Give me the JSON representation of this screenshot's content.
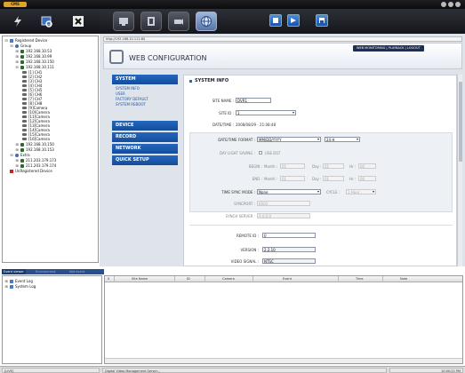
{
  "app": {
    "logo": "CMS"
  },
  "address": "http://192.168.10.111:80",
  "config": {
    "title": "WEB CONFIGURATION"
  },
  "topnav": "WEB MONITORING  |  PLAYBACK  |  LOGOUT",
  "tree": {
    "root": "Registered Device",
    "group": "Group",
    "ips_a": [
      "192.168.10.53",
      "192.168.10.99",
      "192.168.10.150",
      "192.168.10.111"
    ],
    "cams": [
      "[1] CH1",
      "[2] CH2",
      "[3] CH3",
      "[4] CH4",
      "[5] CH5",
      "[6] CH6",
      "[7] CH7",
      "[8] CH8",
      "[9]Camera",
      "[10]Camera",
      "[11]Camera",
      "[12]Camera",
      "[13]Camera",
      "[14]Camera",
      "[15]Camera",
      "[16]Camera"
    ],
    "ips_b": [
      "192.168.10.150",
      "192.168.10.153"
    ],
    "extra": "Extra",
    "extra_ips": [
      "211.203.179.173",
      "211.203.179.174"
    ],
    "unregistered": "UnRegistered Device"
  },
  "nav": {
    "system": "SYSTEM",
    "system_items": [
      "SYSTEM INFO",
      "USER",
      "FACTORY DEFAULT",
      "SYSTEM REBOOT"
    ],
    "device": "DEVICE",
    "record": "RECORD",
    "network": "NETWORK",
    "quick": "QUICK SETUP"
  },
  "sysinfo": {
    "title": "SYSTEM INFO",
    "site_name_label": "SITE NAME :",
    "site_name": "DVR1",
    "site_id_label": "SITE ID :",
    "site_id": "1",
    "datetime_label": "DATE/TIME :",
    "datetime": "2008/08/29 - 21:08:48",
    "dt_format_label": "DATE/TIME FORMAT :",
    "dt_format": "MM/DD/YYYY",
    "hour_format": "24 H",
    "dst_label": "DAY LIGHT SAVING :",
    "use_dst": "USE DST",
    "begin_label": "BEGIN :",
    "end_label": "END :",
    "month_label": "Month :",
    "day_label": "Day :",
    "hr_label": "Hr :",
    "begin_month": "01",
    "begin_day": "01",
    "begin_hr": "00",
    "end_month": "01",
    "end_day": "01",
    "end_hr": "00",
    "sync_mode_label": "TIME SYNC MODE :",
    "sync_mode": "None",
    "cycle_label": "CYCLE :",
    "cycle": "1 Hour",
    "syncport_label": "SYNCPORT :",
    "syncport": "6003",
    "syncserver_label": "SYNCH SERVER :",
    "syncserver": "0.0.0.0",
    "remote_id_label": "REMOTE ID :",
    "remote_id": "0",
    "version_label": "VERSION :",
    "version": "2.2.10",
    "video_signal_label": "VIDEO SIGNAL :",
    "video_signal": "NTSC"
  },
  "events": {
    "tabs": [
      "Event viewer",
      "Environment",
      "Net event"
    ],
    "tree": [
      "Event Log",
      "System Log"
    ]
  },
  "log": {
    "columns": [
      "S",
      "Site Name",
      "ID",
      "Camera",
      "Event",
      "Time",
      "Note"
    ]
  },
  "status": {
    "left": "[LIVE]",
    "middle": "Digital Video Management Server...",
    "right": "10:00:22 PM"
  }
}
